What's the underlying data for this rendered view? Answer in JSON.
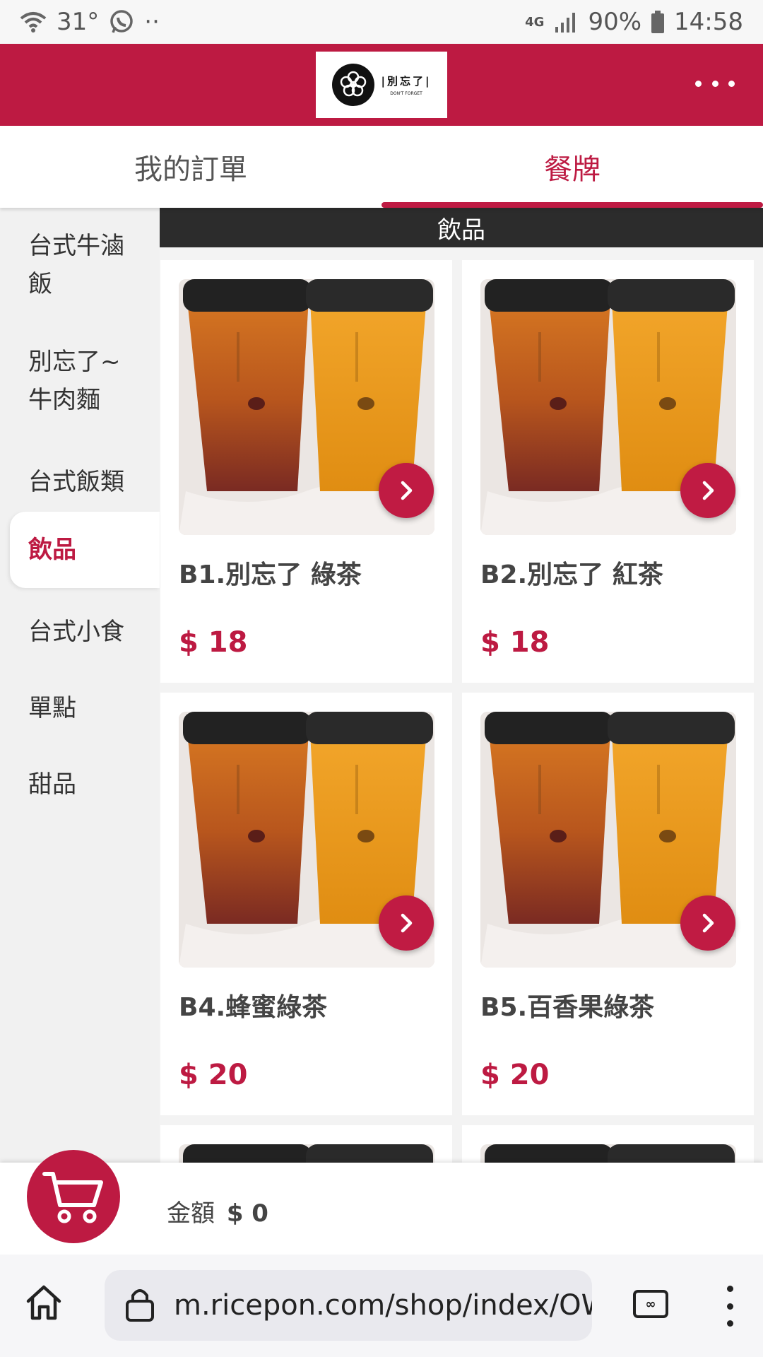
{
  "status_bar": {
    "temperature": "31°",
    "notification_dots": "··",
    "network": "4G",
    "battery": "90%",
    "time": "14:58"
  },
  "header": {
    "logo_text": "|別忘了|",
    "logo_subtext": "DON'T FORGET",
    "brand_color": "#bd1a42"
  },
  "tabs": [
    {
      "label": "我的訂單",
      "active": false
    },
    {
      "label": "餐牌",
      "active": true
    }
  ],
  "sidebar": {
    "items": [
      {
        "label": "台式牛滷飯",
        "active": false
      },
      {
        "label": "別忘了~牛肉麵",
        "active": false
      },
      {
        "label": "台式飯類",
        "active": false
      },
      {
        "label": "飲品",
        "active": true
      },
      {
        "label": "台式小食",
        "active": false
      },
      {
        "label": "單點",
        "active": false
      },
      {
        "label": "甜品",
        "active": false
      }
    ]
  },
  "section": {
    "title": "飲品"
  },
  "products": [
    {
      "name": "B1.別忘了 綠茶",
      "price": "$ 18",
      "image_icon": "drink-photo"
    },
    {
      "name": "B2.別忘了 紅茶",
      "price": "$ 18",
      "image_icon": "drink-photo"
    },
    {
      "name": "B4.蜂蜜綠茶",
      "price": "$ 20",
      "image_icon": "drink-photo"
    },
    {
      "name": "B5.百香果綠茶",
      "price": "$ 20",
      "image_icon": "drink-photo"
    }
  ],
  "cart": {
    "label": "金額",
    "amount": "$ 0"
  },
  "browser": {
    "url": "m.ricepon.com/shop/index/OWIw",
    "tab_count": "∞"
  }
}
